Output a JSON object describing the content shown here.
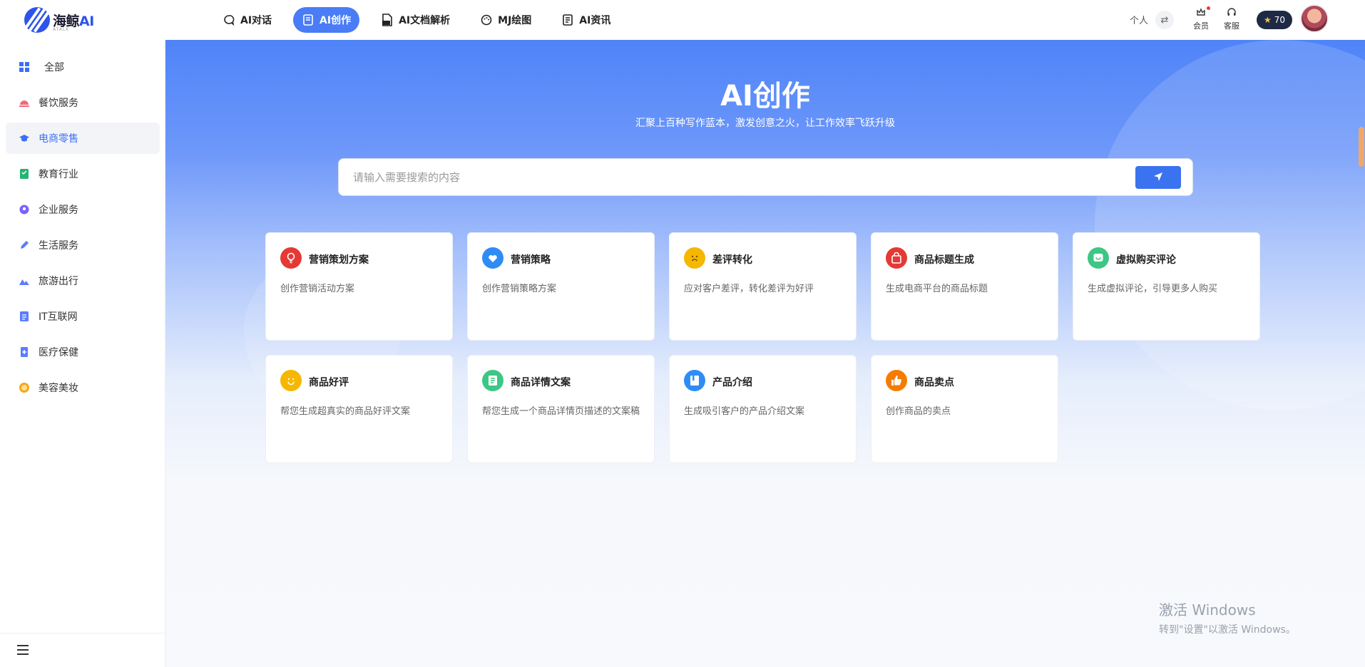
{
  "brand": {
    "name": "海鲸",
    "suffix": "AI",
    "sub": "ATALK"
  },
  "nav": [
    {
      "label": "AI对话",
      "icon": "chat-icon",
      "active": false
    },
    {
      "label": "AI创作",
      "icon": "create-icon",
      "active": true
    },
    {
      "label": "AI文档解析",
      "icon": "pdf-icon",
      "active": false
    },
    {
      "label": "MJ绘图",
      "icon": "palette-icon",
      "active": false
    },
    {
      "label": "AI资讯",
      "icon": "news-icon",
      "active": false
    }
  ],
  "header_right": {
    "personal": "个人",
    "member": "会员",
    "service": "客服",
    "credits": "70"
  },
  "sidebar": {
    "items": [
      {
        "label": "全部",
        "icon": "grid-icon",
        "color": "#3b6ff5"
      },
      {
        "label": "餐饮服务",
        "icon": "dining-icon",
        "color": "#f06a7a"
      },
      {
        "label": "电商零售",
        "icon": "cap-icon",
        "color": "#3b6ff5",
        "active": true
      },
      {
        "label": "教育行业",
        "icon": "book-icon",
        "color": "#22b573"
      },
      {
        "label": "企业服务",
        "icon": "enterprise-icon",
        "color": "#7b61ff"
      },
      {
        "label": "生活服务",
        "icon": "pen-icon",
        "color": "#5a7cff"
      },
      {
        "label": "旅游出行",
        "icon": "mountain-icon",
        "color": "#5a7cff"
      },
      {
        "label": "IT互联网",
        "icon": "code-icon",
        "color": "#5a7cff"
      },
      {
        "label": "医疗保健",
        "icon": "medical-icon",
        "color": "#5a7cff"
      },
      {
        "label": "美容美妆",
        "icon": "beauty-icon",
        "color": "#f5a623"
      }
    ]
  },
  "hero": {
    "title": "AI创作",
    "subtitle": "汇聚上百种写作蓝本，激发创意之火，让工作效率飞跃升级"
  },
  "search": {
    "placeholder": "请输入需要搜索的内容",
    "value": ""
  },
  "cards": [
    {
      "title": "营销策划方案",
      "desc": "创作营销活动方案",
      "icon": "bulb-icon",
      "color": "#e53935"
    },
    {
      "title": "营销策略",
      "desc": "创作营销策略方案",
      "icon": "heart-chat-icon",
      "color": "#2f8cf5"
    },
    {
      "title": "差评转化",
      "desc": "应对客户差评，转化差评为好评",
      "icon": "frown-icon",
      "color": "#f5b700"
    },
    {
      "title": "商品标题生成",
      "desc": "生成电商平台的商品标题",
      "icon": "bag-icon",
      "color": "#e53935"
    },
    {
      "title": "虚拟购买评论",
      "desc": "生成虚拟评论，引导更多人购买",
      "icon": "comment-icon",
      "color": "#3cc784"
    },
    {
      "title": "商品好评",
      "desc": "帮您生成超真实的商品好评文案",
      "icon": "smile-icon",
      "color": "#f5b700"
    },
    {
      "title": "商品详情文案",
      "desc": "帮您生成一个商品详情页描述的文案稿",
      "icon": "doc-icon",
      "color": "#3cc784"
    },
    {
      "title": "产品介绍",
      "desc": "生成吸引客户的产品介绍文案",
      "icon": "book-icon",
      "color": "#2f8cf5"
    },
    {
      "title": "商品卖点",
      "desc": "创作商品的卖点",
      "icon": "thumb-up-icon",
      "color": "#f57c00"
    }
  ],
  "watermark": {
    "line1": "激活 Windows",
    "line2": "转到\"设置\"以激活 Windows。"
  }
}
